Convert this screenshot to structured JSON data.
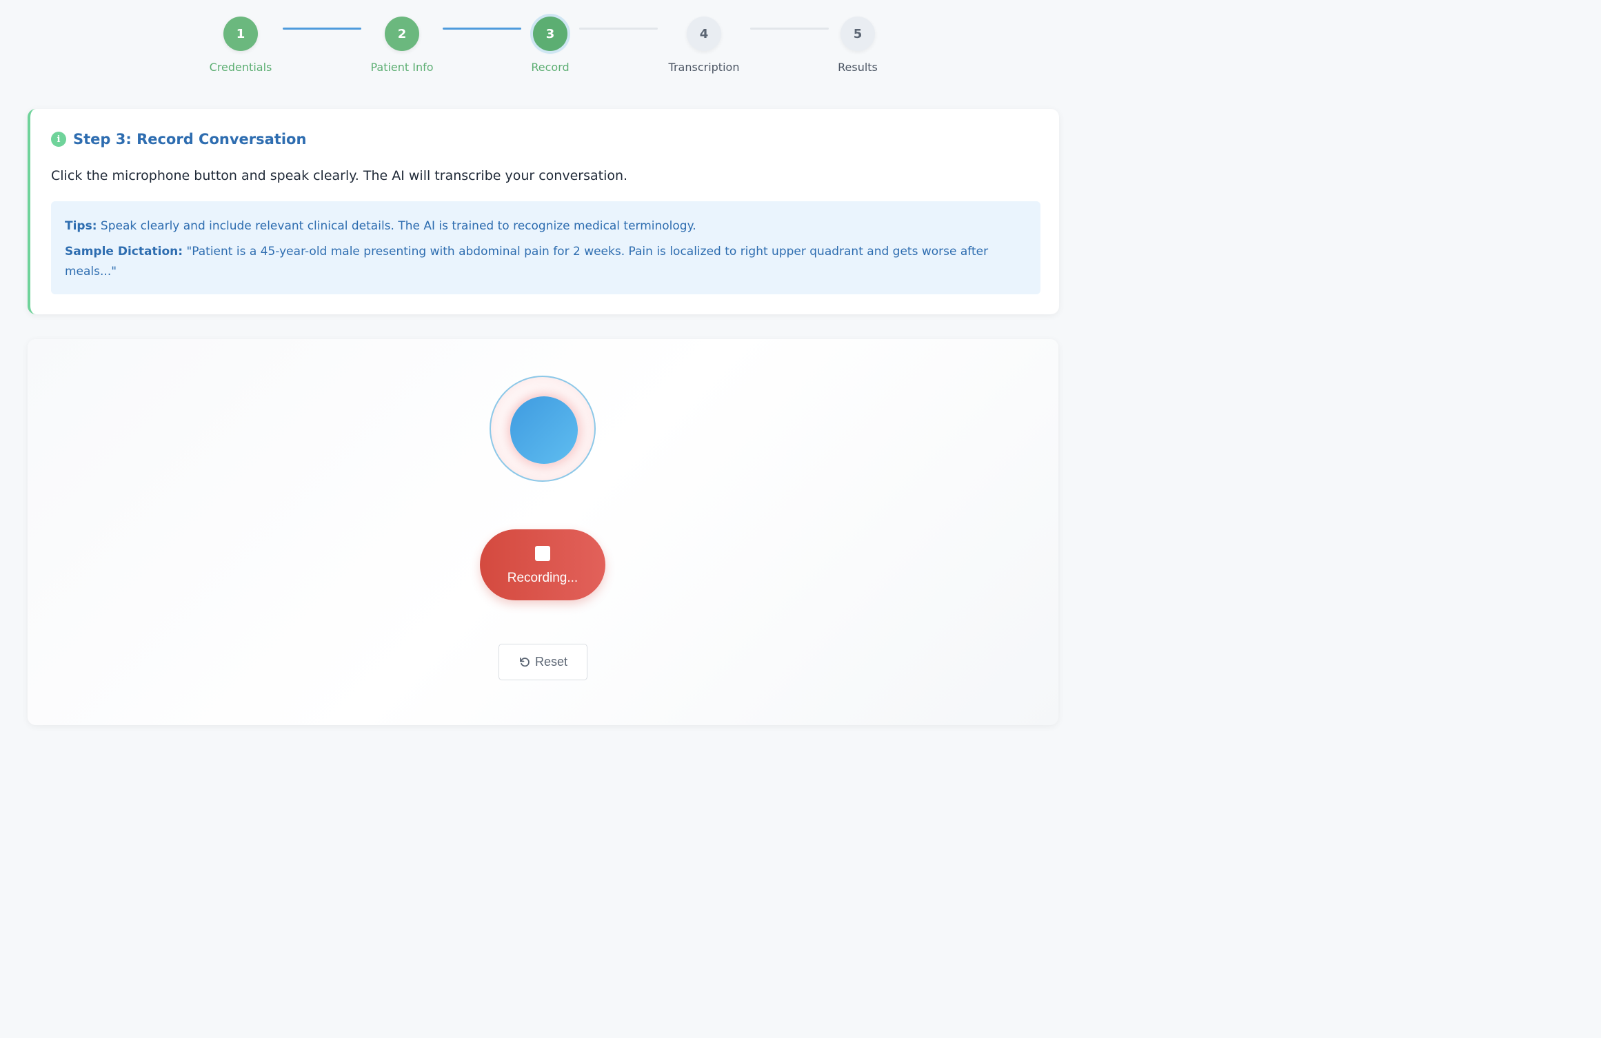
{
  "stepper": {
    "steps": [
      {
        "number": "1",
        "label": "Credentials",
        "state": "done"
      },
      {
        "number": "2",
        "label": "Patient Info",
        "state": "done"
      },
      {
        "number": "3",
        "label": "Record",
        "state": "active"
      },
      {
        "number": "4",
        "label": "Transcription",
        "state": "todo"
      },
      {
        "number": "5",
        "label": "Results",
        "state": "todo"
      }
    ]
  },
  "info_card": {
    "icon": "info-icon",
    "icon_glyph": "i",
    "title": "Step 3: Record Conversation",
    "description": "Click the microphone button and speak clearly. The AI will transcribe your conversation.",
    "tips_label": "Tips:",
    "tips_text": "Speak clearly and include relevant clinical details. The AI is trained to recognize medical terminology.",
    "sample_label": "Sample Dictation:",
    "sample_text": "\"Patient is a 45-year-old male presenting with abdominal pain for 2 weeks. Pain is localized to right upper quadrant and gets worse after meals...\""
  },
  "recorder": {
    "mic_icon": "microphone-icon",
    "stop_icon": "stop-icon",
    "record_label": "Recording...",
    "reset_icon": "undo-icon",
    "reset_label": "Reset"
  },
  "colors": {
    "completed": "#5cae72",
    "connector_active": "#4e9bdc",
    "title_blue": "#2e6db0",
    "recording_red": "#d44a3f",
    "mic_blue": "#4aa7e6"
  }
}
